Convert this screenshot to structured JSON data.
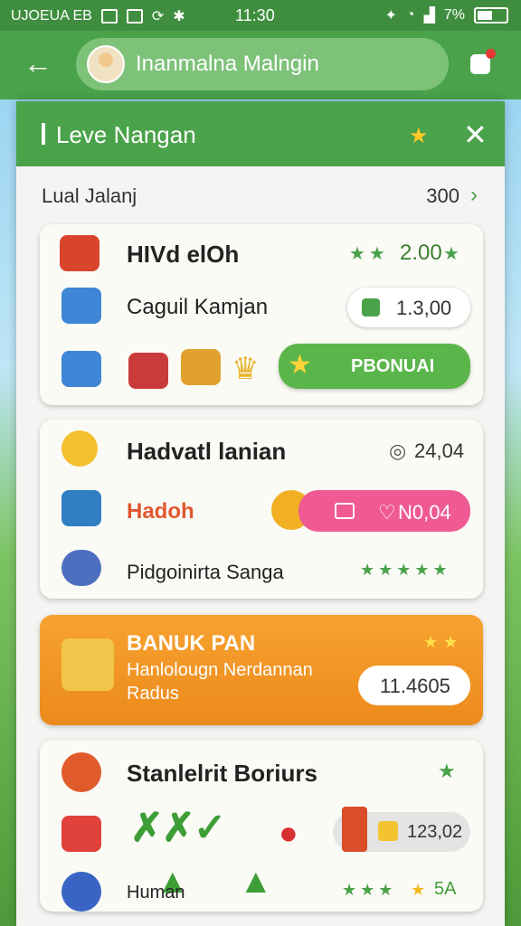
{
  "status": {
    "carrier": "UJOEUA EB",
    "time": "11:30",
    "battery": "7%"
  },
  "header": {
    "title": "Inanmalna Malngin"
  },
  "dialog": {
    "title": "Leve Nangan",
    "level_label": "Lual Jalanj",
    "level_value": "300"
  },
  "card1": {
    "row1_title": "HIVd elOh",
    "row1_value": "2.00",
    "row2_label": "Caguil Kamjan",
    "row2_value": "1.3,00",
    "button_label": "PBONUAI"
  },
  "card2": {
    "row1_title": "Hadvatl lanian",
    "row1_value": "24,04",
    "row2_label": "Hadoh",
    "row2_value": "N0,04",
    "row3_label": "Pidgoinirta Sanga"
  },
  "card3": {
    "title": "BANUK PAN",
    "subtitle_line1": "Hanlolougn Nerdannan",
    "subtitle_line2": "Radus",
    "value": "11.4605"
  },
  "card4": {
    "title": "Stanlelrit Boriurs",
    "value": "123,02",
    "row3_label": "Human",
    "row3_value": "5A"
  },
  "colors": {
    "green": "#4aa24a",
    "orange": "#ef8f20",
    "pink": "#ef5a92"
  }
}
